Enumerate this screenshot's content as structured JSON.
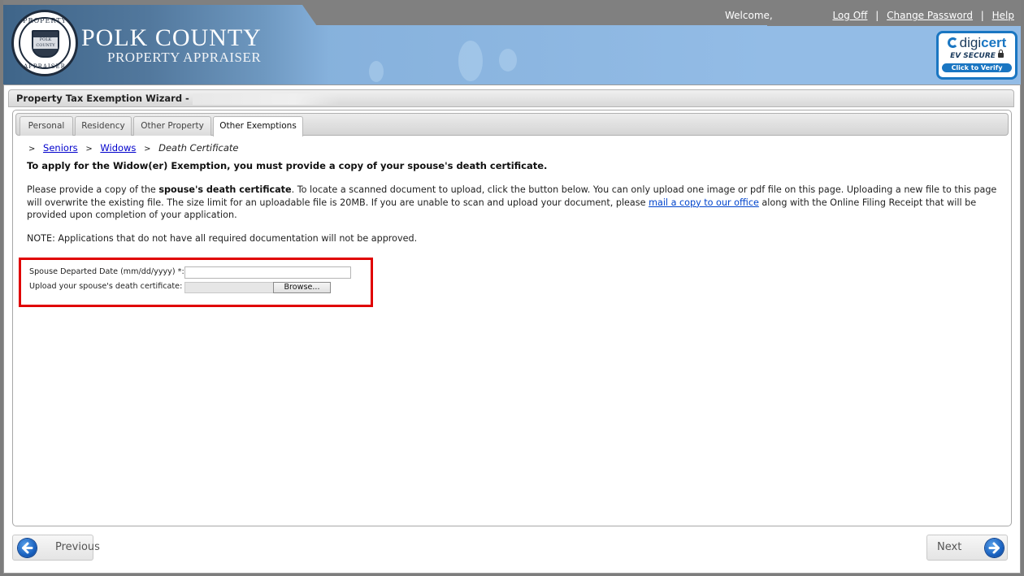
{
  "header": {
    "brand_title": "POLK COUNTY",
    "brand_subtitle": "PROPERTY APPRAISER",
    "seal": {
      "top_text": "PROPERTY",
      "bottom_text": "APPRAISER",
      "band_line1": "POLK",
      "band_line2": "COUNTY"
    },
    "welcome": "Welcome,",
    "links": {
      "log_off": "Log Off",
      "change_password": "Change Password",
      "help": "Help",
      "separator": "|"
    },
    "digicert": {
      "logo_digi": "digi",
      "logo_cert": "cert",
      "ev_secure": "EV SECURE",
      "verify": "Click to Verify"
    }
  },
  "wizard": {
    "title": "Property Tax Exemption Wizard -",
    "tabs": [
      {
        "label": "Personal",
        "active": false
      },
      {
        "label": "Residency",
        "active": false
      },
      {
        "label": "Other Property",
        "active": false
      },
      {
        "label": "Other Exemptions",
        "active": true
      }
    ],
    "breadcrumb": {
      "separator": ">",
      "items": [
        {
          "label": "Seniors",
          "link": true
        },
        {
          "label": "Widows",
          "link": true
        },
        {
          "label": "Death Certificate",
          "link": false
        }
      ]
    },
    "headline": "To apply for the Widow(er) Exemption, you must provide a copy of your spouse's death certificate.",
    "paragraph": {
      "part1": "Please provide a copy of the ",
      "bold": "spouse's death certificate",
      "part2": ". To locate a scanned document to upload, click the button below. You can only upload one image or pdf file on this page. Uploading a new file to this page will overwrite the existing file. The size limit for an uploadable file is 20MB. If you are unable to scan and upload your document, please ",
      "link": "mail a copy to our office",
      "part3": " along with the Online Filing Receipt that will be provided upon completion of your application."
    },
    "note": "NOTE: Applications that do not have all required documentation will not be approved.",
    "form": {
      "date_label": "Spouse Departed Date (mm/dd/yyyy) *:",
      "date_value": "",
      "upload_label": "Upload your spouse's death certificate:",
      "file_value": "",
      "browse_label": "Browse..."
    },
    "nav": {
      "previous_label": "Previous",
      "next_label": "Next"
    }
  },
  "colors": {
    "header_gray": "#808080",
    "banner_blue": "#93bce6",
    "link_blue": "#0000cc",
    "highlight_red": "#e00000",
    "digicert_blue": "#1a76c2"
  }
}
